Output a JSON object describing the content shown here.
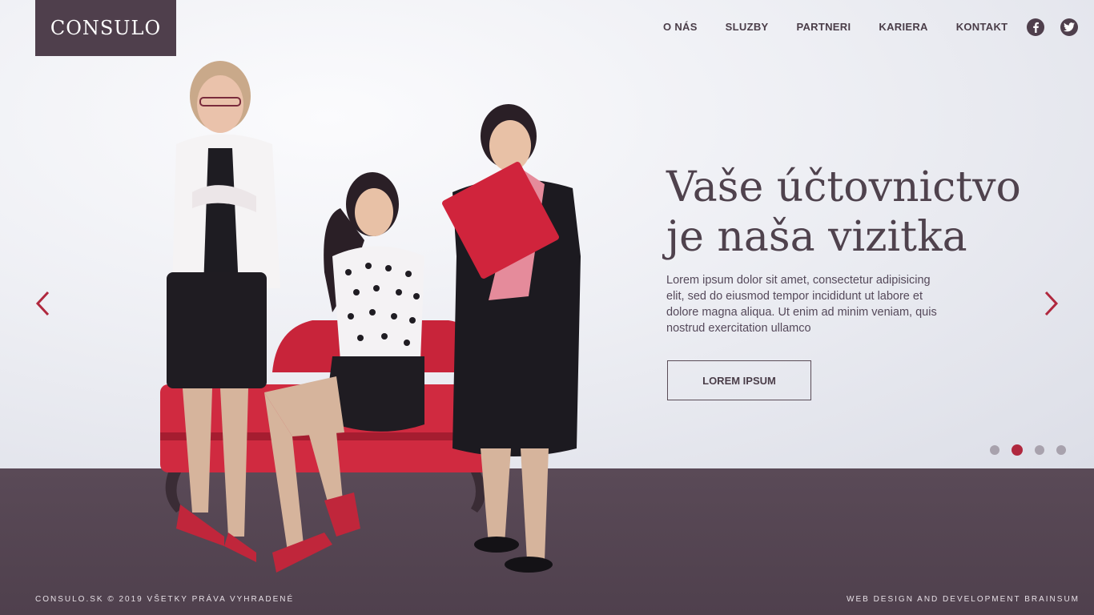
{
  "brand": {
    "logo_text": "CONSULO",
    "logo_color": "#4f3f4c"
  },
  "nav": {
    "items": [
      {
        "label": "O NÁS"
      },
      {
        "label": "SLUZBY"
      },
      {
        "label": "PARTNERI"
      },
      {
        "label": "KARIERA"
      },
      {
        "label": "KONTAKT"
      }
    ]
  },
  "social": {
    "icons": [
      "facebook-icon",
      "twitter-icon"
    ]
  },
  "hero": {
    "title_line1": "Vaše účtovnictvo",
    "title_line2": "je naša vizitka",
    "text": "Lorem ipsum dolor sit amet, consectetur adipisicing elit, sed do eiusmod tempor incididunt ut labore et dolore magna aliqua. Ut enim ad minim veniam, quis nostrud exercitation ullamco",
    "button_label": "LOREM IPSUM"
  },
  "slider": {
    "total": 4,
    "active": 2,
    "accent": "#b0283e"
  },
  "footer": {
    "left": "CONSULO.SK © 2019 VŠETKY PRÁVA VYHRADENÉ",
    "right": "WEB DESIGN AND DEVELOPMENT BRAINSUM"
  }
}
